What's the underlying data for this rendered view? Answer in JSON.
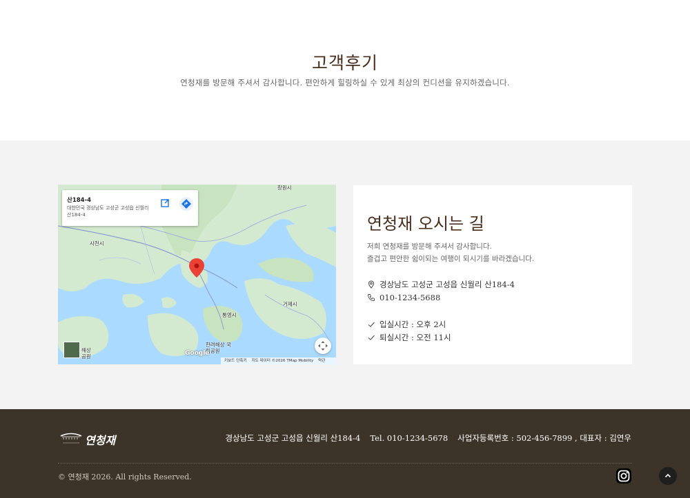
{
  "reviews": {
    "title": "고객후기",
    "subtitle": "연청재를 방문해 주셔서 감사합니다. 편안하게 힐링하실 수 있게 최상의 컨디션을 유지하겠습니다."
  },
  "map": {
    "place_title": "산184-4",
    "place_address": "대한민국 경상남도 고성군 고성읍 신월리 산184-4",
    "labels": {
      "sacheon": "사천시",
      "geoje": "거제시",
      "tongyeong": "통영시",
      "changwon": "창원시",
      "park": "한려해상 국립공원",
      "haesang": "해상 공원"
    },
    "google": "Google",
    "attribution": {
      "shortcuts": "키보드 단축키",
      "data": "지도 데이터 ©2026 TMap Mobility",
      "terms": "약관"
    }
  },
  "directions": {
    "title": "연청재 오시는 길",
    "desc_line1": "저희 연청재를 방문해 주셔서 감사합니다.",
    "desc_line2": "즐겁고 편안한 쉼이되는 여행이 되시기를 바라겠습니다.",
    "address": "경상남도 고성군 고성읍 신월리 산184-4",
    "phone": "010-1234-5688",
    "checkin": "입실시간 : 오후 2시",
    "checkout": "퇴실시간 : 오전 11시"
  },
  "footer": {
    "logo_text": "연청재",
    "address": "경상남도 고성군 고성읍 신월리 산184-4",
    "tel": "Tel. 010-1234-5678",
    "business": "사업자등록번호 : 502-456-7899 , 대표자 : 김연우",
    "copyright": "© 연청재 2026. All rights Reserved."
  },
  "icons": {
    "instagram": "instagram-icon",
    "scroll_top": "chevron-up-icon",
    "location": "map-pin-icon",
    "phone": "phone-icon",
    "check": "check-icon"
  },
  "colors": {
    "heading": "#4a2e1c",
    "footer_bg": "#3d3429",
    "section_bg": "#f3f3f3",
    "map_water": "#aadaff",
    "map_land": "#d4ead0",
    "pin": "#ea4335"
  }
}
